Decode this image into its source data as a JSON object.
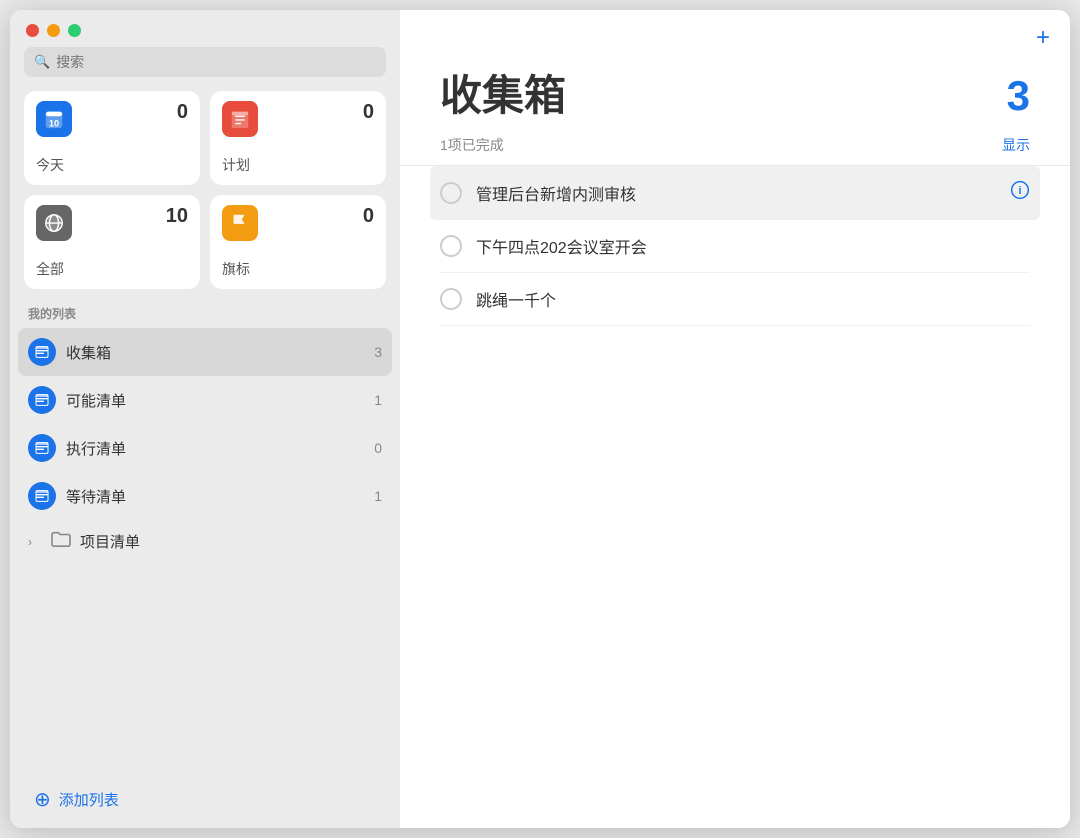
{
  "window": {
    "buttons": {
      "close": "close",
      "minimize": "minimize",
      "maximize": "maximize"
    }
  },
  "sidebar": {
    "search_placeholder": "搜索",
    "quick_cards": [
      {
        "id": "today",
        "icon_type": "today",
        "icon_label": "📅",
        "count": "0",
        "label": "今天"
      },
      {
        "id": "plan",
        "icon_type": "plan",
        "icon_label": "📋",
        "count": "0",
        "label": "计划"
      },
      {
        "id": "all",
        "icon_type": "all",
        "icon_label": "☁",
        "count": "10",
        "label": "全部"
      },
      {
        "id": "flag",
        "icon_type": "flag",
        "icon_label": "🚩",
        "count": "0",
        "label": "旗标"
      }
    ],
    "my_lists_label": "我的列表",
    "lists": [
      {
        "id": "inbox",
        "name": "收集箱",
        "count": "3",
        "active": true
      },
      {
        "id": "maybe",
        "name": "可能清单",
        "count": "1",
        "active": false
      },
      {
        "id": "execute",
        "name": "执行清单",
        "count": "0",
        "active": false
      },
      {
        "id": "waiting",
        "name": "等待清单",
        "count": "1",
        "active": false
      }
    ],
    "project_item": {
      "name": "项目清单"
    },
    "add_list_label": "添加列表"
  },
  "main": {
    "add_button_label": "+",
    "title": "收集箱",
    "count": "3",
    "completed_text": "1项已完成",
    "show_label": "显示",
    "tasks": [
      {
        "id": "task1",
        "text": "管理后台新增内测审核",
        "highlighted": true
      },
      {
        "id": "task2",
        "text": "下午四点202会议室开会",
        "highlighted": false
      },
      {
        "id": "task3",
        "text": "跳绳一千个",
        "highlighted": false
      }
    ]
  },
  "colors": {
    "accent": "#1a73e8",
    "today_icon_bg": "#1a73e8",
    "plan_icon_bg": "#e74c3c",
    "all_icon_bg": "#666666",
    "flag_icon_bg": "#f39c12"
  }
}
